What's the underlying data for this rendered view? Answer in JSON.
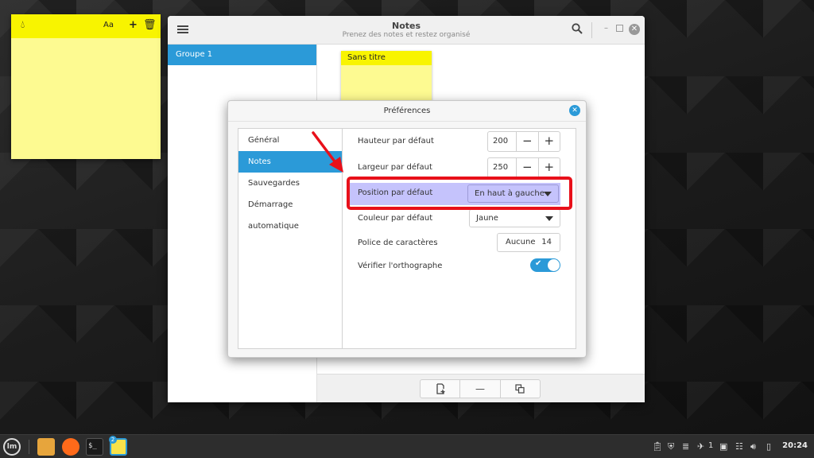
{
  "sticky": {
    "icons": [
      "drop-icon",
      "font-size-icon",
      "plus-icon",
      "trash-icon"
    ],
    "font_label": "Aa"
  },
  "notes_window": {
    "title": "Notes",
    "subtitle": "Prenez des notes et restez organisé",
    "groups": [
      {
        "label": "Groupe 1"
      }
    ],
    "note": {
      "title": "Sans titre"
    }
  },
  "preferences": {
    "title": "Préférences",
    "nav": [
      {
        "label": "Général"
      },
      {
        "label": "Notes"
      },
      {
        "label": "Sauvegardes"
      },
      {
        "label": "Démarrage automatique"
      }
    ],
    "height": {
      "label": "Hauteur par défaut",
      "value": "200"
    },
    "width": {
      "label": "Largeur par défaut",
      "value": "250"
    },
    "position": {
      "label": "Position par défaut",
      "value": "En haut à gauche"
    },
    "color": {
      "label": "Couleur par défaut",
      "value": "Jaune"
    },
    "font": {
      "label": "Police de caractères",
      "name": "Aucune",
      "size": "14"
    },
    "spellcheck": {
      "label": "Vérifier l'orthographe",
      "on": true
    }
  },
  "taskbar": {
    "notes_badge": "2",
    "terminal_glyph": "$_",
    "tray_count": "1",
    "clock": "20:24"
  },
  "colors": {
    "accent": "#2b9ad8",
    "sticky_bar": "#f8f400",
    "sticky_body": "#fdfa91",
    "highlight": "#c5c3fc",
    "annotation_red": "#e8101a"
  }
}
